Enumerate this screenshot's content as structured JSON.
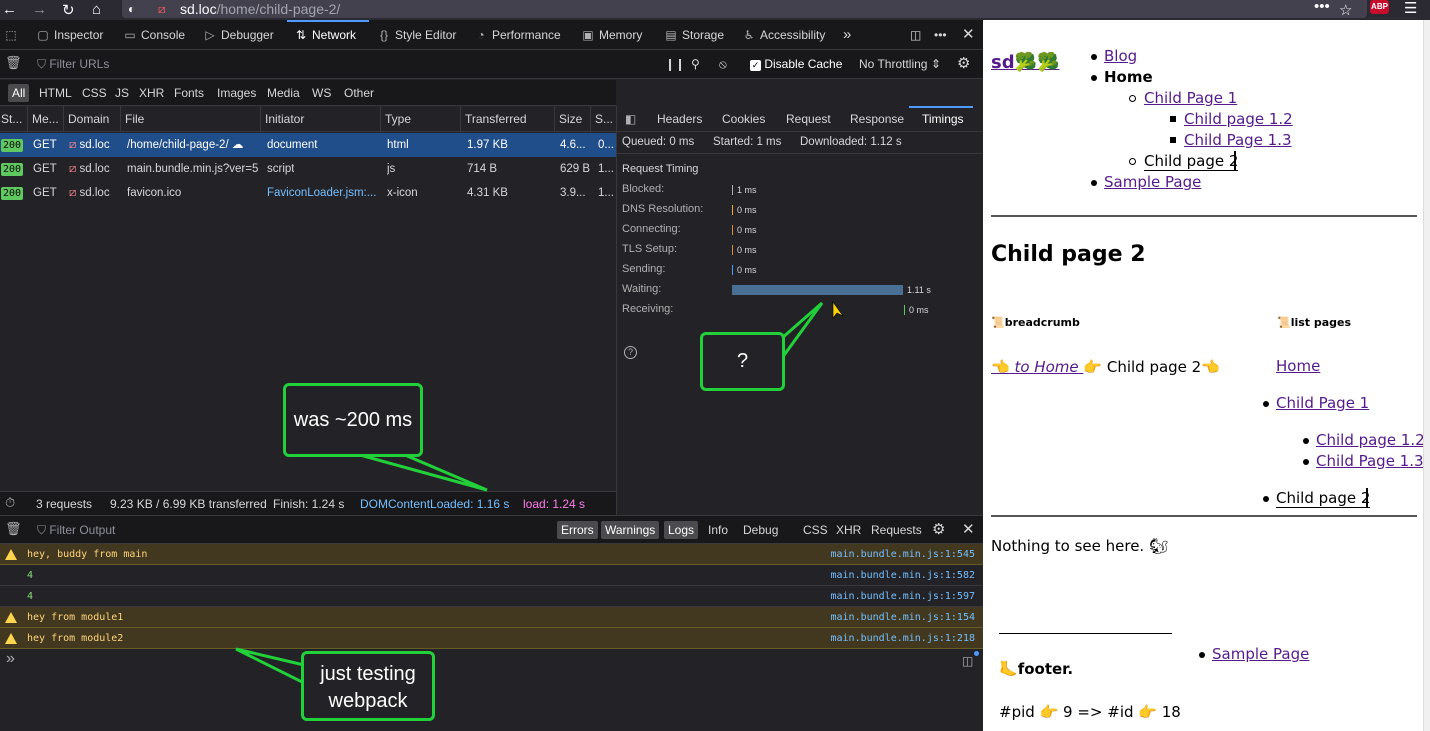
{
  "browser": {
    "url_host": "sd.loc",
    "url_path": "/home/child-page-2/",
    "addon_badge": "ABP"
  },
  "devtools": {
    "tabs": [
      "Inspector",
      "Console",
      "Debugger",
      "Network",
      "Style Editor",
      "Performance",
      "Memory",
      "Storage",
      "Accessibility"
    ],
    "filter_urls_placeholder": "Filter URLs",
    "disable_cache_label": "Disable Cache",
    "throttling_label": "No Throttling",
    "type_filters": [
      "All",
      "HTML",
      "CSS",
      "JS",
      "XHR",
      "Fonts",
      "Images",
      "Media",
      "WS",
      "Other"
    ],
    "columns": [
      "St...",
      "Me...",
      "Domain",
      "File",
      "Initiator",
      "Type",
      "Transferred",
      "Size",
      "S..."
    ],
    "requests": [
      {
        "status": "200",
        "method": "GET",
        "domain": "sd.loc",
        "file": "/home/child-page-2/",
        "initiator": "document",
        "type": "html",
        "transferred": "1.97 KB",
        "size": "4.6...",
        "s": "0..."
      },
      {
        "status": "200",
        "method": "GET",
        "domain": "sd.loc",
        "file": "main.bundle.min.js?ver=5.",
        "initiator": "script",
        "type": "js",
        "transferred": "714 B",
        "size": "629 B",
        "s": "1..."
      },
      {
        "status": "200",
        "method": "GET",
        "domain": "sd.loc",
        "file": "favicon.ico",
        "initiator": "FaviconLoader.jsm:...",
        "type": "x-icon",
        "transferred": "4.31 KB",
        "size": "3.9...",
        "s": "1..."
      }
    ],
    "status_bar": {
      "requests": "3 requests",
      "transferred": "9.23 KB / 6.99 KB transferred",
      "finish": "Finish: 1.24 s",
      "dcl": "DOMContentLoaded: 1.16 s",
      "load": "load: 1.24 s"
    },
    "detail_tabs": [
      "Headers",
      "Cookies",
      "Request",
      "Response",
      "Timings"
    ],
    "summary": {
      "queued": "Queued: 0 ms",
      "started": "Started: 1 ms",
      "downloaded": "Downloaded: 1.12 s"
    },
    "request_timing_title": "Request Timing",
    "timings": [
      {
        "label": "Blocked:",
        "value": "1 ms",
        "color": "#b1b1b3"
      },
      {
        "label": "DNS Resolution:",
        "value": "0 ms",
        "color": "#f5a623"
      },
      {
        "label": "Connecting:",
        "value": "0 ms",
        "color": "#d98e2f"
      },
      {
        "label": "TLS Setup:",
        "value": "0 ms",
        "color": "#d98e2f"
      },
      {
        "label": "Sending:",
        "value": "0 ms",
        "color": "#4e9bfd"
      },
      {
        "label": "Waiting:",
        "value": "1.11 s",
        "color": "#4a6f94"
      },
      {
        "label": "Receiving:",
        "value": "0 ms",
        "color": "#5fc85f"
      }
    ],
    "console": {
      "filter_placeholder": "Filter Output",
      "levels": [
        "Errors",
        "Warnings",
        "Logs",
        "Info",
        "Debug"
      ],
      "extra": [
        "CSS",
        "XHR",
        "Requests"
      ],
      "lines": [
        {
          "kind": "warn",
          "text": "hey, buddy from main",
          "src": "main.bundle.min.js:1:545"
        },
        {
          "kind": "log",
          "text": "4",
          "src": "main.bundle.min.js:1:582"
        },
        {
          "kind": "log",
          "text": "4",
          "src": "main.bundle.min.js:1:597"
        },
        {
          "kind": "warn",
          "text": "hey from module1",
          "src": "main.bundle.min.js:1:154"
        },
        {
          "kind": "warn",
          "text": "hey from module2",
          "src": "main.bundle.min.js:1:218"
        }
      ],
      "prompt": "»"
    }
  },
  "callouts": {
    "was": "was ~200 ms",
    "question": "?",
    "testing_line1": "just testing",
    "testing_line2": "webpack"
  },
  "page": {
    "logo": "sd",
    "nav": {
      "blog": "Blog",
      "home": "Home",
      "child1": "Child Page 1",
      "child12": "Child page 1.2",
      "child13": "Child Page 1.3",
      "child2": "Child page 2",
      "sample": "Sample Page"
    },
    "title": "Child page 2",
    "breadcrumb_heading": "breadcrumb",
    "listpages_heading": "list pages",
    "breadcrumb_link": "to Home",
    "breadcrumb_current": "Child page 2",
    "list": {
      "home": "Home",
      "child1": "Child Page 1",
      "child12": "Child page 1.2",
      "child13": "Child Page 1.3",
      "child2": "Child page 2"
    },
    "nothing": "Nothing to see here.",
    "footer_heading": "footer.",
    "footer_link": "Sample Page",
    "pid_text": "#pid",
    "pid_value": "9 => #id",
    "id_value": "18"
  }
}
